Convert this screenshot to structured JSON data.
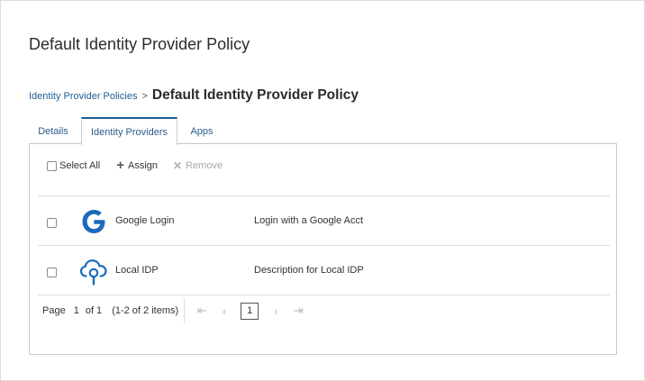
{
  "header": {
    "title": "Default Identity Provider Policy"
  },
  "breadcrumb": {
    "parent_label": "Identity Provider Policies",
    "separator": ">",
    "current_label": "Default Identity Provider Policy"
  },
  "tabs": [
    {
      "label": "Details",
      "active": false
    },
    {
      "label": "Identity Providers",
      "active": true
    },
    {
      "label": "Apps",
      "active": false
    }
  ],
  "toolbar": {
    "select_all_label": "Select All",
    "assign_label": "Assign",
    "remove_label": "Remove",
    "assign_icon": "plus-icon",
    "remove_icon": "close-icon"
  },
  "providers": [
    {
      "name": "Google Login",
      "description": "Login with a Google Acct",
      "icon": "google-icon",
      "checked": false
    },
    {
      "name": "Local IDP",
      "description": "Description for Local IDP",
      "icon": "cloud-key-icon",
      "checked": false
    }
  ],
  "pagination": {
    "page_label": "Page",
    "current_page": "1",
    "of_label": "of 1",
    "items_label": "(1-2 of 2 items)",
    "page_box_value": "1"
  },
  "colors": {
    "accent": "#1b5e96",
    "google_blue": "#1a6bbd"
  }
}
